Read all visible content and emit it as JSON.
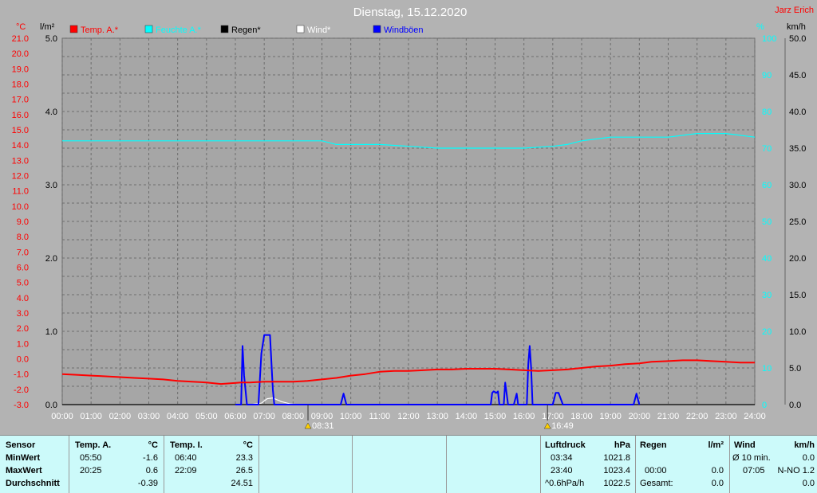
{
  "header": {
    "title": "Dienstag, 15.12.2020",
    "author": "Jarz Erich",
    "unit_celsius": "°C",
    "unit_rain": "l/m²",
    "unit_percent": "%",
    "unit_kmh": "km/h"
  },
  "legend": [
    {
      "label": "Temp. A.*",
      "color": "#ff0000"
    },
    {
      "label": "Feuchte A.*",
      "color": "#00ffff"
    },
    {
      "label": "Regen*",
      "color": "#000000"
    },
    {
      "label": "Wind*",
      "color": "#ffffff"
    },
    {
      "label": "Windböen",
      "color": "#0000ff"
    }
  ],
  "sun": {
    "rise": "08:31",
    "set": "16:49"
  },
  "chart_data": {
    "type": "line",
    "title": "Dienstag, 15.12.2020",
    "x_range": [
      0,
      24
    ],
    "x_ticks": [
      "00:00",
      "01:00",
      "02:00",
      "03:00",
      "04:00",
      "05:00",
      "06:00",
      "07:00",
      "08:00",
      "09:00",
      "10:00",
      "11:00",
      "12:00",
      "13:00",
      "14:00",
      "15:00",
      "16:00",
      "17:00",
      "18:00",
      "19:00",
      "20:00",
      "21:00",
      "22:00",
      "23:00",
      "24:00"
    ],
    "temp_axis": {
      "unit": "°C",
      "range": [
        -3,
        21
      ],
      "ticks": [
        "21.0",
        "20.0",
        "19.0",
        "18.0",
        "17.0",
        "16.0",
        "15.0",
        "14.0",
        "13.0",
        "12.0",
        "11.0",
        "10.0",
        "9.0",
        "8.0",
        "7.0",
        "6.0",
        "5.0",
        "4.0",
        "3.0",
        "2.0",
        "1.0",
        "0.0",
        "-1.0",
        "-2.0",
        "-3.0"
      ]
    },
    "rain_axis": {
      "unit": "l/m²",
      "range": [
        0,
        5
      ],
      "ticks": [
        "5.0",
        "4.0",
        "3.0",
        "2.0",
        "1.0",
        "0.0"
      ]
    },
    "humidity_axis": {
      "unit": "%",
      "range": [
        0,
        100
      ],
      "ticks": [
        "100",
        "90",
        "80",
        "70",
        "60",
        "50",
        "40",
        "30",
        "20",
        "10",
        "0"
      ]
    },
    "wind_axis": {
      "unit": "km/h",
      "range": [
        0,
        50
      ],
      "ticks": [
        "50.0",
        "45.0",
        "40.0",
        "35.0",
        "30.0",
        "25.0",
        "20.0",
        "15.0",
        "10.0",
        "5.0",
        "0.0"
      ]
    },
    "series": [
      {
        "name": "Temp. A.*",
        "axis": "temp",
        "color": "#ff0000",
        "x": [
          0,
          0.5,
          1,
          1.5,
          2,
          2.5,
          3,
          3.5,
          4,
          4.5,
          5,
          5.5,
          5.83,
          6.2,
          6.5,
          7,
          7.5,
          8,
          8.5,
          9,
          9.5,
          10,
          10.5,
          11,
          11.5,
          12,
          12.5,
          13,
          13.5,
          14,
          14.5,
          15,
          15.5,
          16,
          16.5,
          17,
          17.5,
          18,
          18.5,
          19,
          19.5,
          20,
          20.42,
          21,
          21.5,
          22,
          22.5,
          23,
          23.5,
          24
        ],
        "y": [
          -1.0,
          -1.05,
          -1.1,
          -1.15,
          -1.2,
          -1.25,
          -1.3,
          -1.35,
          -1.45,
          -1.5,
          -1.55,
          -1.65,
          -1.6,
          -1.55,
          -1.55,
          -1.5,
          -1.5,
          -1.5,
          -1.45,
          -1.35,
          -1.25,
          -1.1,
          -1.0,
          -0.85,
          -0.8,
          -0.8,
          -0.75,
          -0.7,
          -0.7,
          -0.65,
          -0.65,
          -0.65,
          -0.7,
          -0.75,
          -0.8,
          -0.75,
          -0.7,
          -0.6,
          -0.5,
          -0.45,
          -0.35,
          -0.3,
          -0.2,
          -0.15,
          -0.1,
          -0.1,
          -0.15,
          -0.2,
          -0.25,
          -0.25
        ]
      },
      {
        "name": "Feuchte A.*",
        "axis": "humidity",
        "color": "#00ffff",
        "x": [
          0,
          1,
          2,
          3,
          4,
          5,
          6,
          7,
          8,
          9,
          9.5,
          10,
          11,
          12,
          13,
          14,
          15,
          16,
          17,
          17.5,
          18,
          19,
          20,
          21,
          22,
          23,
          24
        ],
        "y": [
          72,
          72,
          72,
          72,
          72,
          72,
          72,
          72,
          72,
          72,
          71,
          71,
          71,
          70.5,
          70,
          70,
          70,
          70,
          70.5,
          71,
          72,
          73,
          73,
          73,
          74,
          74,
          73
        ]
      },
      {
        "name": "Regen*",
        "axis": "rain",
        "color": "#000000",
        "x": [
          0,
          24
        ],
        "y": [
          0,
          0
        ]
      },
      {
        "name": "Wind*",
        "axis": "wind",
        "color": "#ffffff",
        "x": [
          6.5,
          6.9,
          7.1,
          7.3,
          7.6,
          7.9,
          8.2
        ],
        "y": [
          0,
          0.2,
          0.8,
          0.9,
          0.4,
          0.1,
          0
        ]
      },
      {
        "name": "Windböen",
        "axis": "wind",
        "color": "#0000ff",
        "x": [
          6.0,
          6.2,
          6.25,
          6.3,
          6.4,
          6.45,
          6.8,
          6.9,
          7.0,
          7.2,
          7.3,
          7.35,
          9.65,
          9.75,
          9.85,
          14.85,
          14.9,
          14.95,
          15.05,
          15.1,
          15.15,
          15.3,
          15.35,
          15.45,
          15.5,
          15.55,
          15.65,
          15.75,
          15.8,
          15.85,
          16.1,
          16.15,
          16.2,
          16.25,
          16.3,
          16.35,
          17.0,
          17.1,
          17.2,
          17.35,
          19.8,
          19.9,
          20.0
        ],
        "y": [
          0,
          0,
          8,
          4,
          0,
          0,
          0,
          7,
          9.5,
          9.5,
          2,
          0,
          0,
          1.5,
          0,
          0,
          1.6,
          1.8,
          1.6,
          1.8,
          0,
          0,
          3,
          0,
          0,
          0,
          0,
          1.5,
          0,
          0,
          0,
          5.5,
          8,
          5,
          0,
          0,
          0,
          1.6,
          1.6,
          0,
          0,
          1.5,
          0
        ]
      }
    ]
  },
  "footer": {
    "sensor": {
      "label": "Sensor",
      "min": "MinWert",
      "max": "MaxWert",
      "avg": "Durchschnitt"
    },
    "temp_a": {
      "label": "Temp. A.",
      "unit": "°C",
      "min_time": "05:50",
      "min_val": "-1.6",
      "max_time": "20:25",
      "max_val": "0.6",
      "avg_val": "-0.39"
    },
    "temp_i": {
      "label": "Temp. I.",
      "unit": "°C",
      "min_time": "06:40",
      "min_val": "23.3",
      "max_time": "22:09",
      "max_val": "26.5",
      "avg_val": "24.51"
    },
    "pressure": {
      "label": "Luftdruck",
      "unit": "hPa",
      "min_time": "03:34",
      "min_val": "1021.8",
      "max_time": "23:40",
      "max_val": "1023.4",
      "trend_label": "^0.6hPa/h",
      "trend_val": "1022.5"
    },
    "rain": {
      "label": "Regen",
      "unit": "l/m²",
      "max_time": "00:00",
      "max_val": "0.0",
      "total_label": "Gesamt:",
      "total_val": "0.0"
    },
    "wind": {
      "label": "Wind",
      "unit": "km/h",
      "avg10_label": "Ø 10 min.",
      "avg10_val": "0.0",
      "max_time": "07:05",
      "max_val": "N-NO 1.2",
      "avg_val": "0.0"
    }
  }
}
